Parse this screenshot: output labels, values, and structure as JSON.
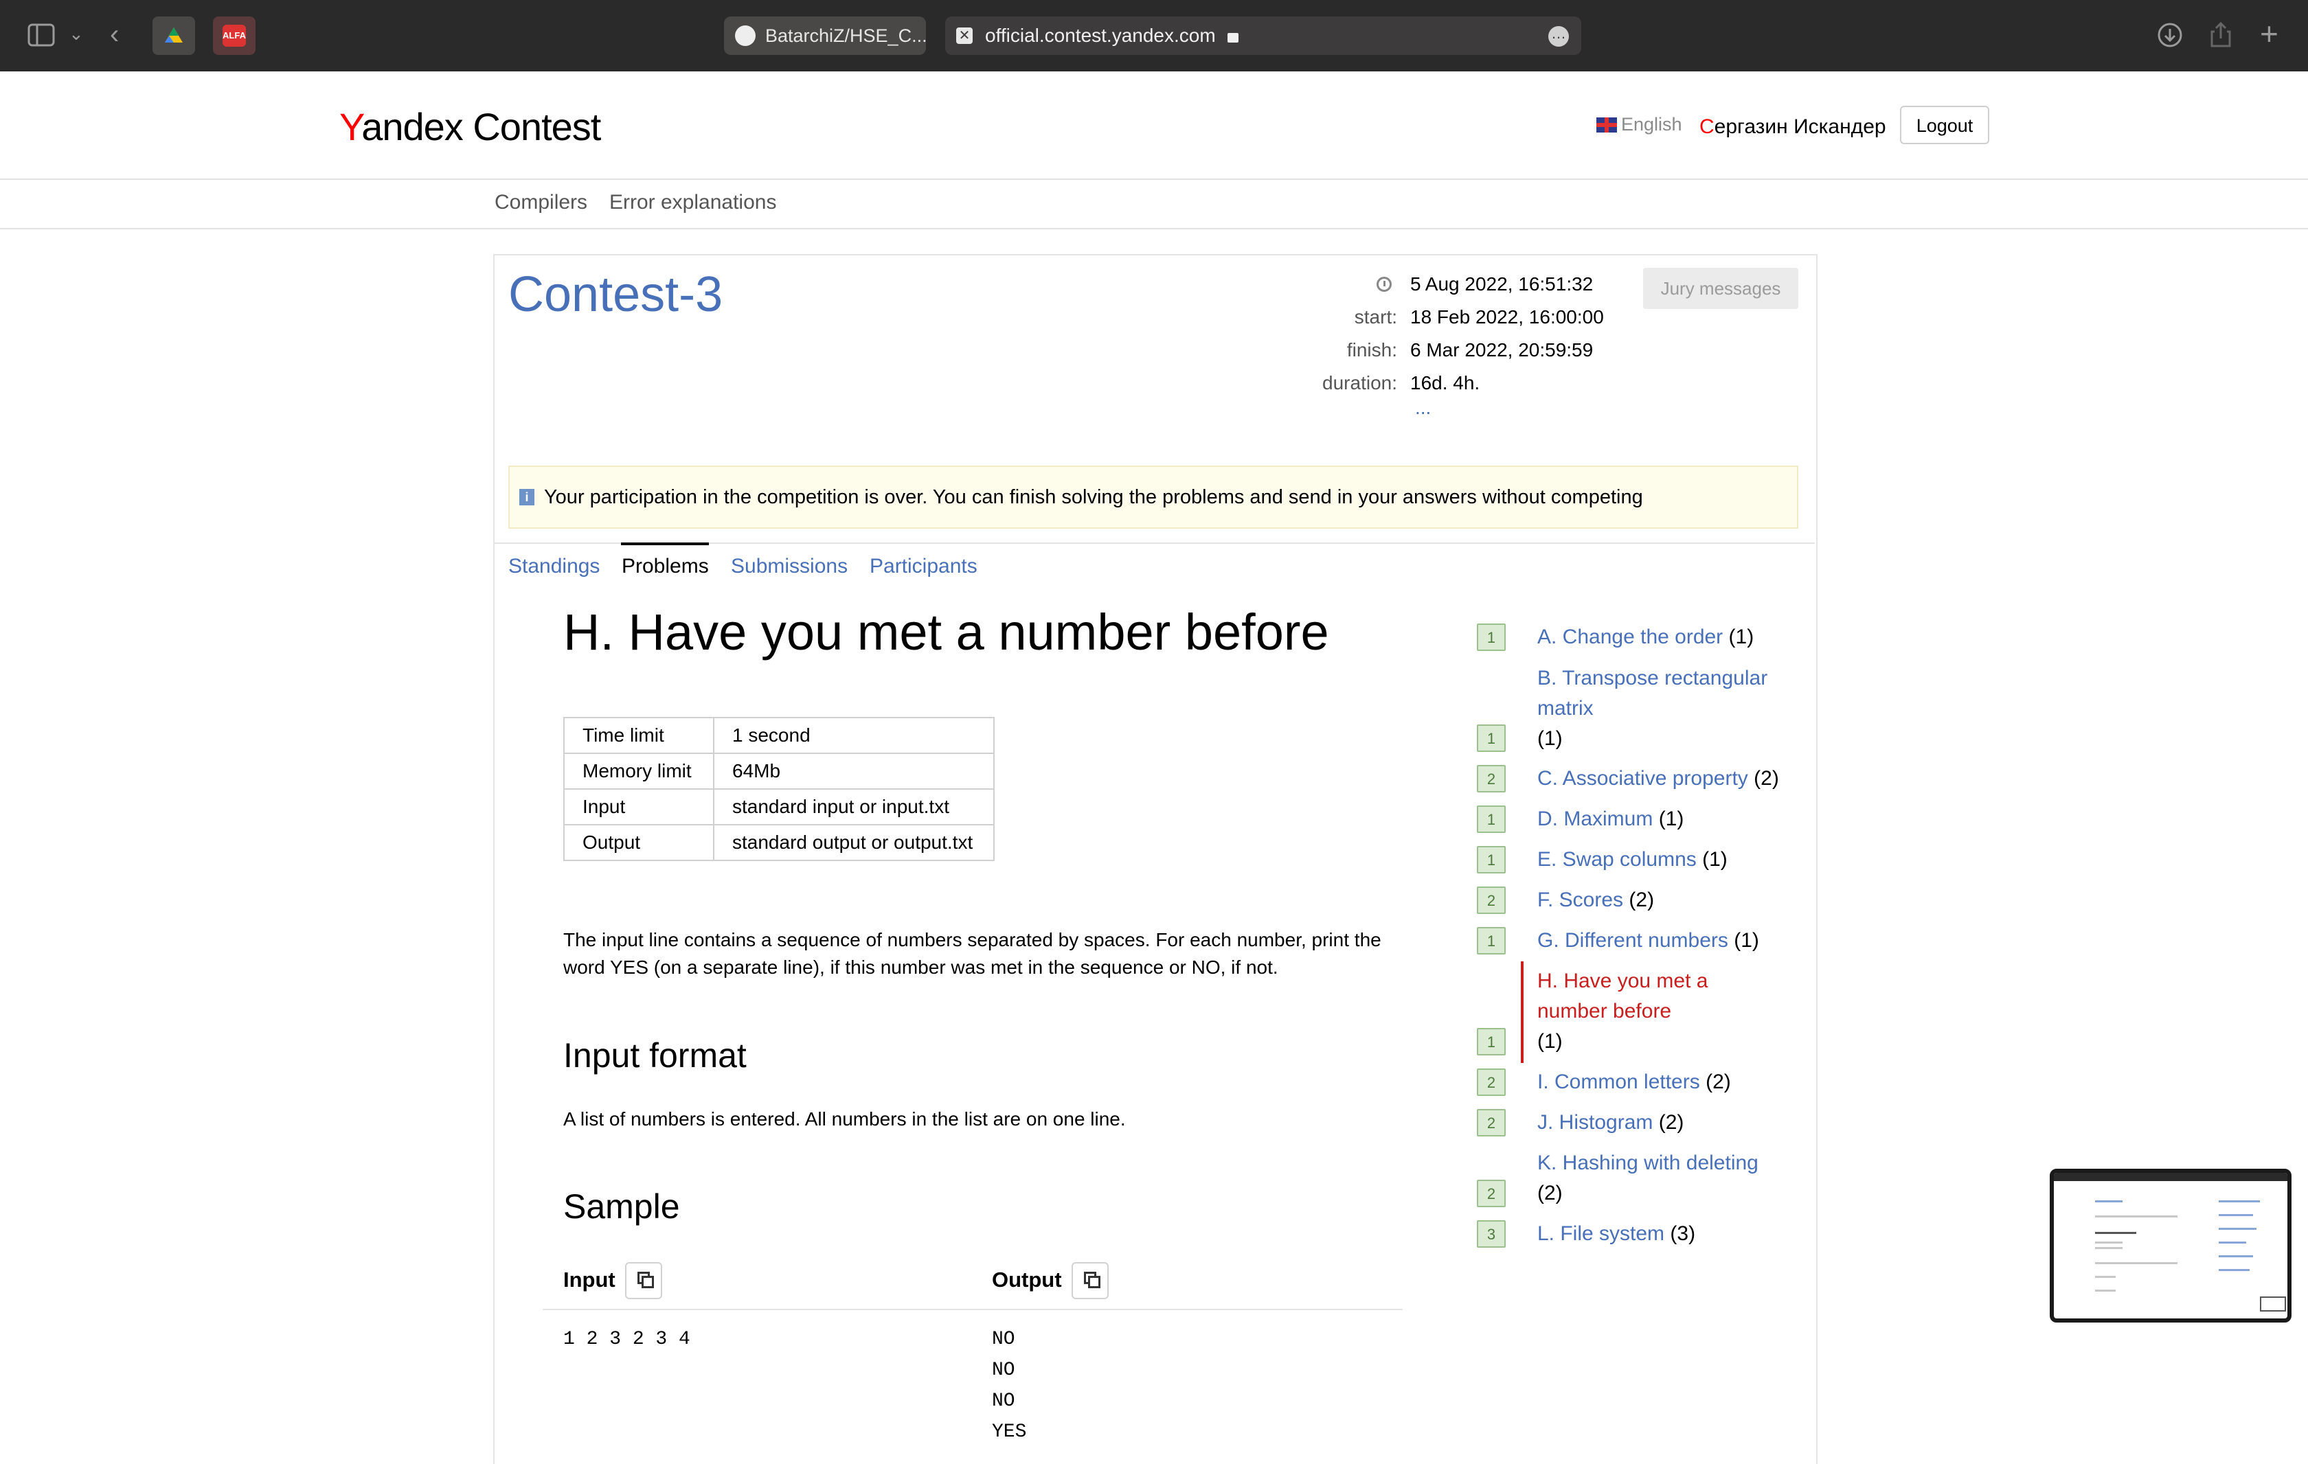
{
  "browser": {
    "tab_github": "BatarchiZ/HSE_C...",
    "url": "official.contest.yandex.com",
    "ext1": "Google Drive",
    "ext2": "ALFA"
  },
  "header": {
    "logo_y": "Y",
    "logo_rest": "andex Contest",
    "language": "English",
    "user_first": "С",
    "user_rest": "ергазин Искандер",
    "logout": "Logout"
  },
  "subnav": {
    "compilers": "Compilers",
    "errors": "Error explanations"
  },
  "contest": {
    "title": "Contest-3",
    "now": "5 Aug 2022, 16:51:32",
    "start_label": "start:",
    "start": "18 Feb 2022, 16:00:00",
    "finish_label": "finish:",
    "finish": "6 Mar 2022, 20:59:59",
    "duration_label": "duration:",
    "duration": "16d. 4h.",
    "more": "...",
    "jury": "Jury messages",
    "notice": "Your participation in the competition is over. You can finish solving the problems and send in your answers without competing",
    "tabs": [
      "Standings",
      "Problems",
      "Submissions",
      "Participants"
    ]
  },
  "problem": {
    "title": "H. Have you met a number before",
    "limits": [
      {
        "k": "Time limit",
        "v": "1 second"
      },
      {
        "k": "Memory limit",
        "v": "64Mb"
      },
      {
        "k": "Input",
        "v": "standard input or input.txt"
      },
      {
        "k": "Output",
        "v": "standard output or output.txt"
      }
    ],
    "statement": "The input line contains a sequence of numbers separated by spaces. For each number, print the word YES (on a separate line), if this number was met in the sequence or NO, if not.",
    "input_format_title": "Input format",
    "input_format": "A list of numbers is entered. All numbers in the list are on one line.",
    "sample_title": "Sample",
    "sample_input_label": "Input",
    "sample_output_label": "Output",
    "sample_input": "1 2 3 2 3 4",
    "sample_output": "NO\nNO\nNO\nYES"
  },
  "problem_list": [
    {
      "badge": "1",
      "name": "A. Change the order",
      "count": "(1)"
    },
    {
      "badge": "1",
      "name": "B. Transpose rectangular matrix",
      "count": "(1)"
    },
    {
      "badge": "2",
      "name": "C. Associative property",
      "count": "(2)"
    },
    {
      "badge": "1",
      "name": "D. Maximum",
      "count": "(1)"
    },
    {
      "badge": "1",
      "name": "E. Swap columns",
      "count": "(1)"
    },
    {
      "badge": "2",
      "name": "F. Scores",
      "count": "(2)"
    },
    {
      "badge": "1",
      "name": "G. Different numbers",
      "count": "(1)"
    },
    {
      "badge": "1",
      "name": "H. Have you met a number before",
      "count": "(1)"
    },
    {
      "badge": "2",
      "name": "I. Common letters",
      "count": "(2)"
    },
    {
      "badge": "2",
      "name": "J. Histogram",
      "count": "(2)"
    },
    {
      "badge": "2",
      "name": "K. Hashing with deleting",
      "count": "(2)"
    },
    {
      "badge": "3",
      "name": "L. File system",
      "count": "(3)"
    }
  ],
  "colors": {
    "link": "#4770b8",
    "accent_red": "#c81e1e",
    "badge_green": "#dcecd4"
  }
}
